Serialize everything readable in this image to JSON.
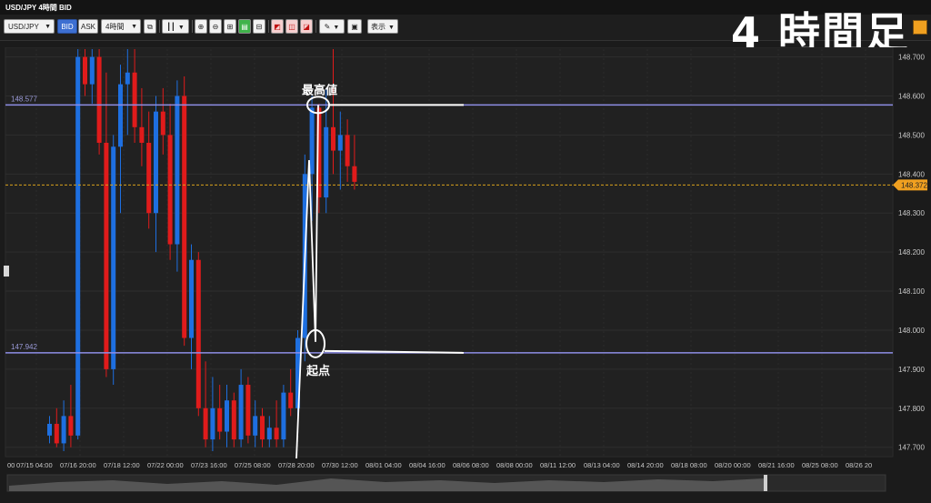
{
  "window": {
    "title": "USD/JPY 4時間 BID"
  },
  "overlay_label": "4 時間足",
  "toolbar": {
    "symbol": "USD/JPY",
    "bid_label": "BID",
    "ask_label": "ASK",
    "timeframe": "4時間",
    "display_label": "表示",
    "accent_color": "#3d6fd1"
  },
  "icons": [
    "chevron-down-icon",
    "chart-type-icon",
    "zoom-in-icon",
    "zoom-out-icon",
    "fit-icon",
    "auto-scroll-icon",
    "shift-icon",
    "order-icon",
    "copy-icon",
    "draw-icon",
    "pen-icon",
    "screenshot-icon",
    "settings-icon"
  ],
  "chart_data": {
    "type": "candlestick",
    "y_range": [
      147.69,
      148.72
    ],
    "y_ticks": [
      "148.700",
      "148.600",
      "148.500",
      "148.400",
      "148.300",
      "148.200",
      "148.100",
      "148.000",
      "147.900",
      "147.800",
      "147.700"
    ],
    "x_ticks": [
      "07/15 04:00",
      "07/16 20:00",
      "07/18 12:00",
      "07/22 00:00",
      "07/23 16:00",
      "07/25 08:00",
      "07/28 20:00",
      "07/30 12:00",
      "08/01 04:00",
      "08/04 16:00",
      "08/06 08:00",
      "08/08 00:00",
      "08/11 12:00",
      "08/13 04:00",
      "08/14 20:00",
      "08/18 08:00",
      "08/20 00:00",
      "08/21 16:00",
      "08/25 08:00",
      "08/26 20"
    ],
    "current_price": "148.372",
    "horizontal_lines": [
      {
        "label": "148.577",
        "value": 148.577
      },
      {
        "label": "147.942",
        "value": 147.942
      }
    ],
    "annotations": {
      "high_label": "最高値",
      "start_label": "起点"
    },
    "up_color": "#1e6fe0",
    "down_color": "#e01b1b",
    "candles": [
      {
        "o": 147.73,
        "h": 147.78,
        "l": 147.71,
        "c": 147.76
      },
      {
        "o": 147.76,
        "h": 147.8,
        "l": 147.7,
        "c": 147.71
      },
      {
        "o": 147.71,
        "h": 147.82,
        "l": 147.69,
        "c": 147.78
      },
      {
        "o": 147.78,
        "h": 147.86,
        "l": 147.7,
        "c": 147.73
      },
      {
        "o": 147.73,
        "h": 148.72,
        "l": 147.72,
        "c": 148.7
      },
      {
        "o": 148.7,
        "h": 148.72,
        "l": 148.6,
        "c": 148.63
      },
      {
        "o": 148.63,
        "h": 148.72,
        "l": 148.58,
        "c": 148.7
      },
      {
        "o": 148.7,
        "h": 148.72,
        "l": 148.45,
        "c": 148.48
      },
      {
        "o": 148.48,
        "h": 148.66,
        "l": 147.88,
        "c": 147.9
      },
      {
        "o": 147.9,
        "h": 148.5,
        "l": 147.86,
        "c": 148.47
      },
      {
        "o": 148.47,
        "h": 148.68,
        "l": 148.3,
        "c": 148.63
      },
      {
        "o": 148.63,
        "h": 148.72,
        "l": 148.5,
        "c": 148.66
      },
      {
        "o": 148.66,
        "h": 148.72,
        "l": 148.48,
        "c": 148.52
      },
      {
        "o": 148.52,
        "h": 148.62,
        "l": 148.42,
        "c": 148.48
      },
      {
        "o": 148.48,
        "h": 148.56,
        "l": 148.26,
        "c": 148.3
      },
      {
        "o": 148.3,
        "h": 148.6,
        "l": 148.2,
        "c": 148.56
      },
      {
        "o": 148.56,
        "h": 148.62,
        "l": 148.45,
        "c": 148.5
      },
      {
        "o": 148.5,
        "h": 148.58,
        "l": 148.18,
        "c": 148.22
      },
      {
        "o": 148.22,
        "h": 148.64,
        "l": 148.15,
        "c": 148.6
      },
      {
        "o": 148.6,
        "h": 148.65,
        "l": 147.96,
        "c": 147.98
      },
      {
        "o": 147.98,
        "h": 148.22,
        "l": 147.9,
        "c": 148.18
      },
      {
        "o": 148.18,
        "h": 148.2,
        "l": 147.78,
        "c": 147.8
      },
      {
        "o": 147.8,
        "h": 147.92,
        "l": 147.7,
        "c": 147.72
      },
      {
        "o": 147.72,
        "h": 147.88,
        "l": 147.69,
        "c": 147.8
      },
      {
        "o": 147.8,
        "h": 147.86,
        "l": 147.72,
        "c": 147.74
      },
      {
        "o": 147.74,
        "h": 147.86,
        "l": 147.7,
        "c": 147.82
      },
      {
        "o": 147.82,
        "h": 147.84,
        "l": 147.7,
        "c": 147.72
      },
      {
        "o": 147.72,
        "h": 147.9,
        "l": 147.7,
        "c": 147.86
      },
      {
        "o": 147.86,
        "h": 147.88,
        "l": 147.71,
        "c": 147.73
      },
      {
        "o": 147.73,
        "h": 147.82,
        "l": 147.7,
        "c": 147.78
      },
      {
        "o": 147.78,
        "h": 147.8,
        "l": 147.7,
        "c": 147.72
      },
      {
        "o": 147.72,
        "h": 147.78,
        "l": 147.7,
        "c": 147.75
      },
      {
        "o": 147.75,
        "h": 147.82,
        "l": 147.7,
        "c": 147.72
      },
      {
        "o": 147.72,
        "h": 147.86,
        "l": 147.7,
        "c": 147.84
      },
      {
        "o": 147.84,
        "h": 147.9,
        "l": 147.78,
        "c": 147.8
      },
      {
        "o": 147.8,
        "h": 148.0,
        "l": 147.78,
        "c": 147.98
      },
      {
        "o": 147.98,
        "h": 148.45,
        "l": 147.92,
        "c": 148.4
      },
      {
        "o": 148.4,
        "h": 148.6,
        "l": 148.28,
        "c": 148.57
      },
      {
        "o": 148.57,
        "h": 148.58,
        "l": 148.3,
        "c": 148.34
      },
      {
        "o": 148.34,
        "h": 148.62,
        "l": 148.3,
        "c": 148.52
      },
      {
        "o": 148.52,
        "h": 148.72,
        "l": 148.4,
        "c": 148.46
      },
      {
        "o": 148.46,
        "h": 148.56,
        "l": 148.36,
        "c": 148.5
      },
      {
        "o": 148.5,
        "h": 148.54,
        "l": 148.38,
        "c": 148.42
      },
      {
        "o": 148.42,
        "h": 148.5,
        "l": 148.36,
        "c": 148.38
      }
    ]
  }
}
